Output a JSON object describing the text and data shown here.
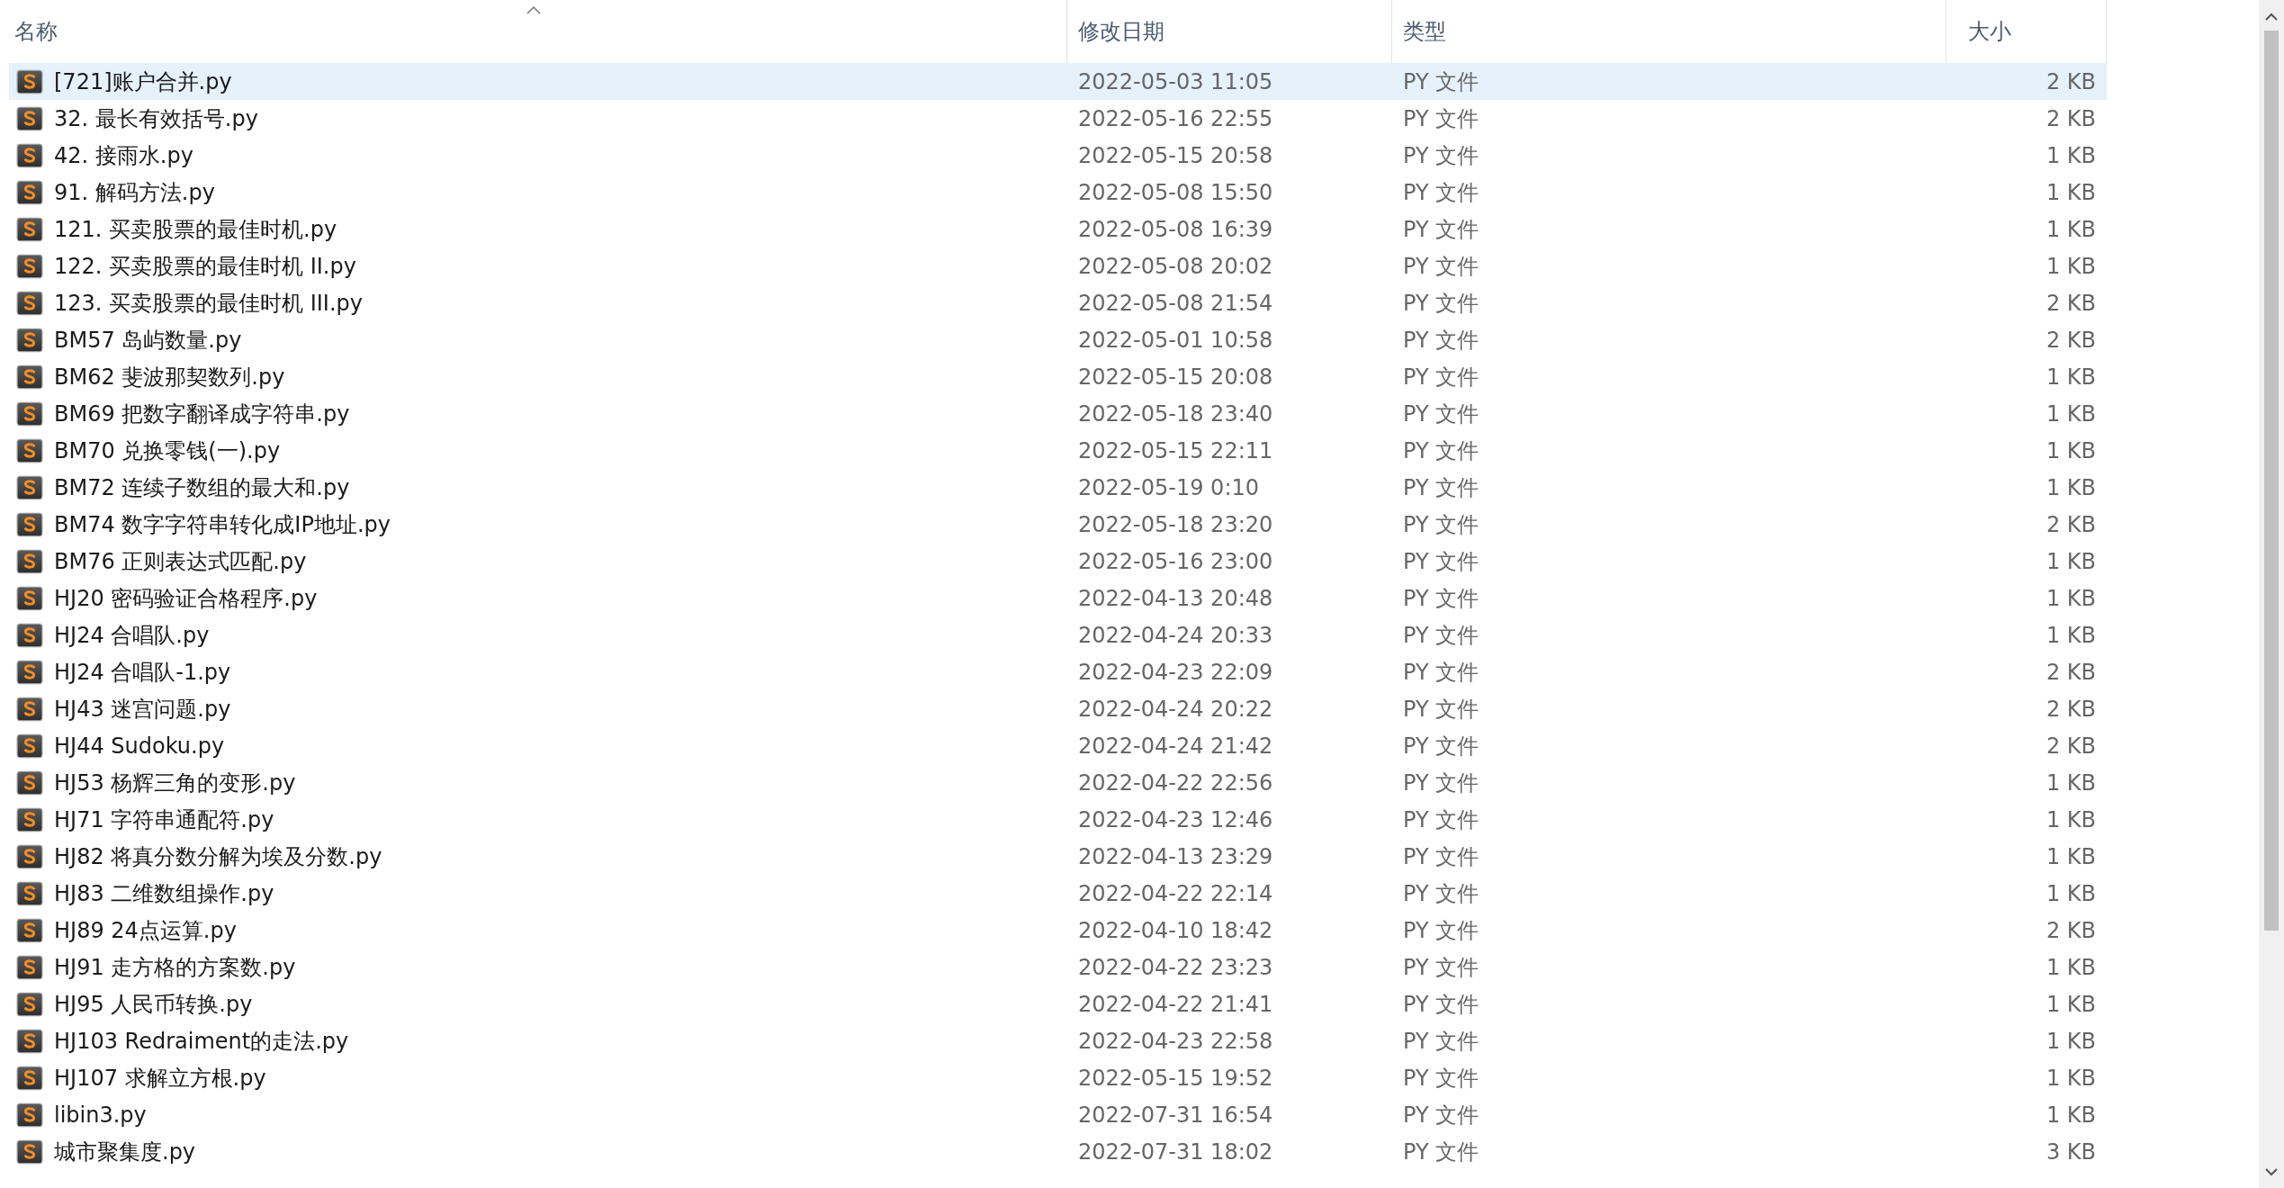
{
  "columns": [
    {
      "label": "名称",
      "sorted": true
    },
    {
      "label": "修改日期",
      "sorted": false
    },
    {
      "label": "类型",
      "sorted": false
    },
    {
      "label": "大小",
      "sorted": false
    }
  ],
  "files": [
    {
      "name": "[721]账户合并.py",
      "modified": "2022-05-03 11:05",
      "type": "PY 文件",
      "size": "2 KB",
      "selected": true
    },
    {
      "name": "32. 最长有效括号.py",
      "modified": "2022-05-16 22:55",
      "type": "PY 文件",
      "size": "2 KB",
      "selected": false
    },
    {
      "name": "42. 接雨水.py",
      "modified": "2022-05-15 20:58",
      "type": "PY 文件",
      "size": "1 KB",
      "selected": false
    },
    {
      "name": "91. 解码方法.py",
      "modified": "2022-05-08 15:50",
      "type": "PY 文件",
      "size": "1 KB",
      "selected": false
    },
    {
      "name": "121. 买卖股票的最佳时机.py",
      "modified": "2022-05-08 16:39",
      "type": "PY 文件",
      "size": "1 KB",
      "selected": false
    },
    {
      "name": "122. 买卖股票的最佳时机 II.py",
      "modified": "2022-05-08 20:02",
      "type": "PY 文件",
      "size": "1 KB",
      "selected": false
    },
    {
      "name": "123. 买卖股票的最佳时机 III.py",
      "modified": "2022-05-08 21:54",
      "type": "PY 文件",
      "size": "2 KB",
      "selected": false
    },
    {
      "name": "BM57 岛屿数量.py",
      "modified": "2022-05-01 10:58",
      "type": "PY 文件",
      "size": "2 KB",
      "selected": false
    },
    {
      "name": "BM62 斐波那契数列.py",
      "modified": "2022-05-15 20:08",
      "type": "PY 文件",
      "size": "1 KB",
      "selected": false
    },
    {
      "name": "BM69 把数字翻译成字符串.py",
      "modified": "2022-05-18 23:40",
      "type": "PY 文件",
      "size": "1 KB",
      "selected": false
    },
    {
      "name": "BM70 兑换零钱(一).py",
      "modified": "2022-05-15 22:11",
      "type": "PY 文件",
      "size": "1 KB",
      "selected": false
    },
    {
      "name": "BM72 连续子数组的最大和.py",
      "modified": "2022-05-19 0:10",
      "type": "PY 文件",
      "size": "1 KB",
      "selected": false
    },
    {
      "name": "BM74 数字字符串转化成IP地址.py",
      "modified": "2022-05-18 23:20",
      "type": "PY 文件",
      "size": "2 KB",
      "selected": false
    },
    {
      "name": "BM76 正则表达式匹配.py",
      "modified": "2022-05-16 23:00",
      "type": "PY 文件",
      "size": "1 KB",
      "selected": false
    },
    {
      "name": "HJ20 密码验证合格程序.py",
      "modified": "2022-04-13 20:48",
      "type": "PY 文件",
      "size": "1 KB",
      "selected": false
    },
    {
      "name": "HJ24 合唱队.py",
      "modified": "2022-04-24 20:33",
      "type": "PY 文件",
      "size": "1 KB",
      "selected": false
    },
    {
      "name": "HJ24 合唱队-1.py",
      "modified": "2022-04-23 22:09",
      "type": "PY 文件",
      "size": "2 KB",
      "selected": false
    },
    {
      "name": "HJ43 迷宫问题.py",
      "modified": "2022-04-24 20:22",
      "type": "PY 文件",
      "size": "2 KB",
      "selected": false
    },
    {
      "name": "HJ44 Sudoku.py",
      "modified": "2022-04-24 21:42",
      "type": "PY 文件",
      "size": "2 KB",
      "selected": false
    },
    {
      "name": "HJ53 杨辉三角的变形.py",
      "modified": "2022-04-22 22:56",
      "type": "PY 文件",
      "size": "1 KB",
      "selected": false
    },
    {
      "name": "HJ71 字符串通配符.py",
      "modified": "2022-04-23 12:46",
      "type": "PY 文件",
      "size": "1 KB",
      "selected": false
    },
    {
      "name": "HJ82 将真分数分解为埃及分数.py",
      "modified": "2022-04-13 23:29",
      "type": "PY 文件",
      "size": "1 KB",
      "selected": false
    },
    {
      "name": "HJ83 二维数组操作.py",
      "modified": "2022-04-22 22:14",
      "type": "PY 文件",
      "size": "1 KB",
      "selected": false
    },
    {
      "name": "HJ89 24点运算.py",
      "modified": "2022-04-10 18:42",
      "type": "PY 文件",
      "size": "2 KB",
      "selected": false
    },
    {
      "name": "HJ91 走方格的方案数.py",
      "modified": "2022-04-22 23:23",
      "type": "PY 文件",
      "size": "1 KB",
      "selected": false
    },
    {
      "name": "HJ95 人民币转换.py",
      "modified": "2022-04-22 21:41",
      "type": "PY 文件",
      "size": "1 KB",
      "selected": false
    },
    {
      "name": "HJ103 Redraiment的走法.py",
      "modified": "2022-04-23 22:58",
      "type": "PY 文件",
      "size": "1 KB",
      "selected": false
    },
    {
      "name": "HJ107 求解立方根.py",
      "modified": "2022-05-15 19:52",
      "type": "PY 文件",
      "size": "1 KB",
      "selected": false
    },
    {
      "name": "libin3.py",
      "modified": "2022-07-31 16:54",
      "type": "PY 文件",
      "size": "1 KB",
      "selected": false
    },
    {
      "name": "城市聚集度.py",
      "modified": "2022-07-31 18:02",
      "type": "PY 文件",
      "size": "3 KB",
      "selected": false
    }
  ]
}
